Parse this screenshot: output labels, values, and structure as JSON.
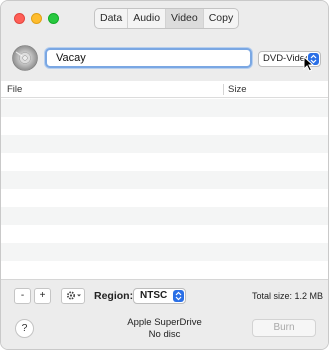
{
  "tabs": [
    {
      "label": "Data"
    },
    {
      "label": "Audio"
    },
    {
      "label": "Video",
      "active": true
    },
    {
      "label": "Copy"
    }
  ],
  "toolbar": {
    "disc_name_value": "Vacay",
    "format_selected": "DVD-Video"
  },
  "table": {
    "columns": {
      "file": "File",
      "size": "Size"
    },
    "rows": []
  },
  "controls": {
    "remove_label": "-",
    "add_label": "+",
    "region_label": "Region:",
    "region_selected": "NTSC",
    "total_size": "Total size: 1.2 MB"
  },
  "footer": {
    "help_label": "?",
    "drive_name": "Apple SuperDrive",
    "drive_status": "No disc",
    "burn_label": "Burn"
  },
  "colors": {
    "accent": "#2a6fe6",
    "focus_ring": "#7aa7e3",
    "close": "#ff5f57",
    "minimize": "#febc2e",
    "zoom": "#28c840"
  },
  "icons": [
    "close-icon",
    "minimize-icon",
    "zoom-icon",
    "disc-icon",
    "select-arrows-icon",
    "gear-icon",
    "pointer-cursor-icon",
    "help-icon"
  ]
}
